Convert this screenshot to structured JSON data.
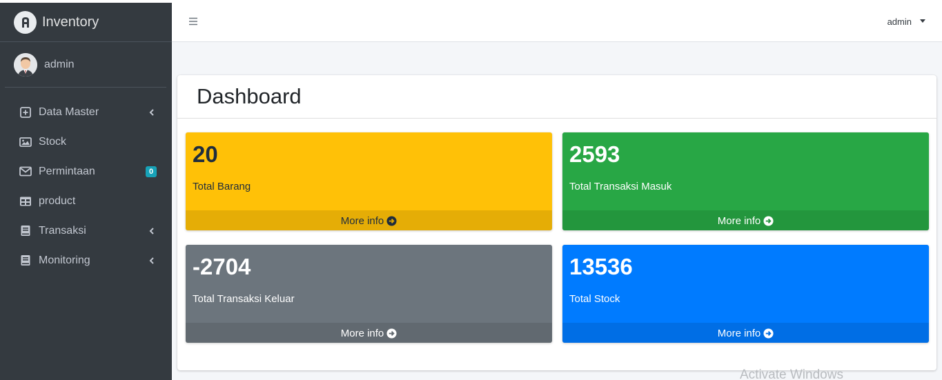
{
  "brand": {
    "title": "Inventory"
  },
  "user": {
    "name": "admin"
  },
  "sidebar": {
    "items": [
      {
        "label": "Data Master",
        "icon": "plus-square-icon",
        "has_chevron": true
      },
      {
        "label": "Stock",
        "icon": "image-icon",
        "has_chevron": false
      },
      {
        "label": "Permintaan",
        "icon": "envelope-icon",
        "badge": "0"
      },
      {
        "label": "product",
        "icon": "table-icon",
        "has_chevron": false
      },
      {
        "label": "Transaksi",
        "icon": "book-icon",
        "has_chevron": true
      },
      {
        "label": "Monitoring",
        "icon": "book-icon",
        "has_chevron": true
      }
    ]
  },
  "header": {
    "user_label": "admin"
  },
  "main": {
    "title": "Dashboard",
    "boxes": [
      {
        "value": "20",
        "label": "Total Barang",
        "footer": "More info",
        "color": "#ffc107"
      },
      {
        "value": "2593",
        "label": "Total Transaksi Masuk",
        "footer": "More info",
        "color": "#28a745"
      },
      {
        "value": "-2704",
        "label": "Total Transaksi Keluar",
        "footer": "More info",
        "color": "#6c757d"
      },
      {
        "value": "13536",
        "label": "Total Stock",
        "footer": "More info",
        "color": "#007bff"
      }
    ]
  },
  "watermark": "Activate Windows"
}
